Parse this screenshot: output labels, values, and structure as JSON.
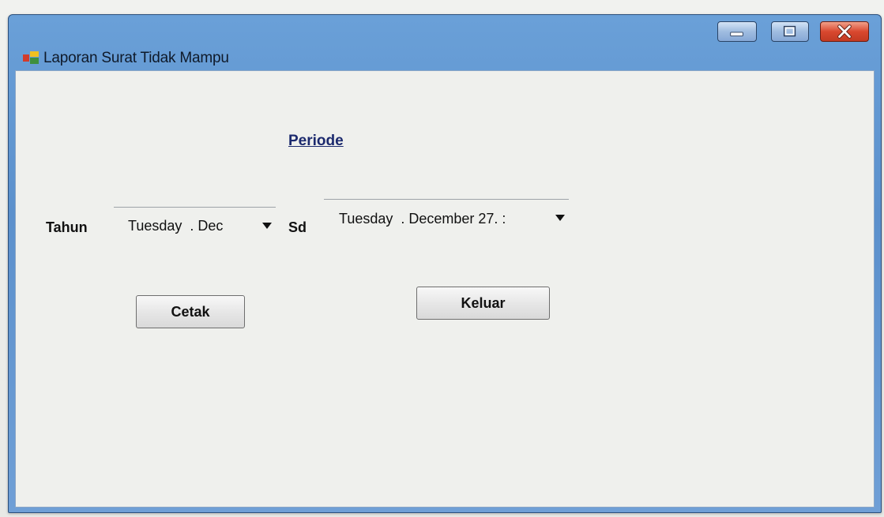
{
  "window": {
    "title": "Laporan Surat Tidak Mampu"
  },
  "form": {
    "periode_label": "Periode",
    "tahun_label": "Tahun",
    "sd_label": "Sd",
    "date_from": "Tuesday  . Dec",
    "date_to": "Tuesday  . December 27. :",
    "cetak_button": "Cetak",
    "keluar_button": "Keluar"
  },
  "icons": {
    "app": "app-icon",
    "minimize": "minimize-icon",
    "maximize": "maximize-icon",
    "close": "close-icon",
    "dropdown": "chevron-down-icon"
  },
  "colors": {
    "titlebar": "#6aa0d8",
    "close_button": "#d9482f",
    "client_bg": "#eff0ed",
    "periode_text": "#1c2a6e"
  }
}
